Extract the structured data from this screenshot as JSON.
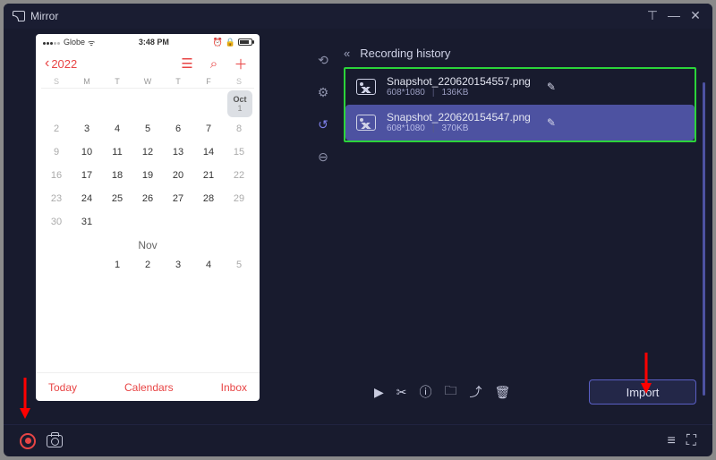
{
  "app": {
    "title": "Mirror"
  },
  "phone": {
    "carrier": "Globe",
    "time": "3:48 PM",
    "year": "2022",
    "dow": [
      "S",
      "M",
      "T",
      "W",
      "T",
      "F",
      "S"
    ],
    "oct_label": "Oct",
    "oct_day": "1",
    "weeks": [
      [
        "2",
        "3",
        "4",
        "5",
        "6",
        "7",
        "8"
      ],
      [
        "9",
        "10",
        "11",
        "12",
        "13",
        "14",
        "15"
      ],
      [
        "16",
        "17",
        "18",
        "19",
        "20",
        "21",
        "22"
      ],
      [
        "23",
        "24",
        "25",
        "26",
        "27",
        "28",
        "29"
      ],
      [
        "30",
        "31",
        "",
        "",
        "",
        "",
        ""
      ]
    ],
    "nov_label": "Nov",
    "nov_row": [
      "",
      "",
      "1",
      "2",
      "3",
      "4",
      "5"
    ],
    "today": "Today",
    "calendars": "Calendars",
    "inbox": "Inbox"
  },
  "panel": {
    "title": "Recording history",
    "files": [
      {
        "name": "Snapshot_220620154557.png",
        "dim": "608*1080",
        "size": "136KB",
        "selected": false
      },
      {
        "name": "Snapshot_220620154547.png",
        "dim": "608*1080",
        "size": "370KB",
        "selected": true
      }
    ],
    "import": "Import"
  }
}
